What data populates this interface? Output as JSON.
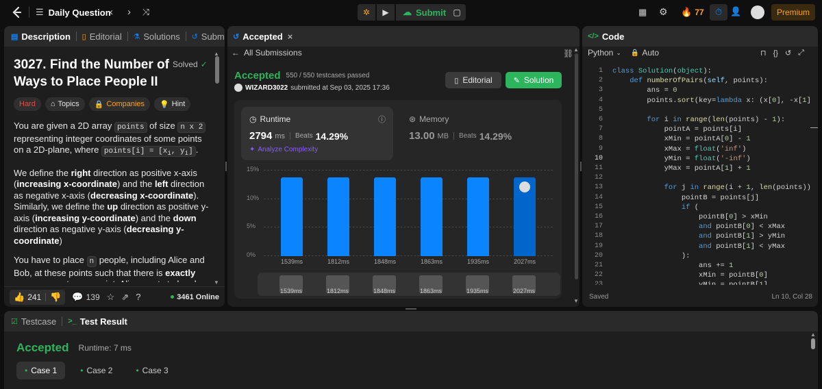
{
  "topbar": {
    "problem_list": "Daily Question",
    "submit": "Submit",
    "streak": "77",
    "premium": "Premium"
  },
  "left": {
    "tabs": [
      "Description",
      "Editorial",
      "Solutions",
      "Submissio"
    ],
    "title_line1": "3027. Find the Number of",
    "title_line2": "Ways to Place People II",
    "solved": "Solved",
    "tags": {
      "difficulty": "Hard",
      "topics": "Topics",
      "companies": "Companies",
      "hint": "Hint"
    },
    "likes": "241",
    "comments": "139",
    "online": "3461 Online"
  },
  "middle": {
    "tab": "Accepted",
    "back": "All Submissions",
    "status": "Accepted",
    "testcases": "550 / 550 testcases passed",
    "user": "WIZARD3022",
    "submitted": "submitted at Sep 03, 2025 17:36",
    "editorial_btn": "Editorial",
    "solution_btn": "Solution",
    "runtime_label": "Runtime",
    "runtime_value": "2794",
    "runtime_unit": "ms",
    "beats_label": "Beats",
    "runtime_beats": "14.29%",
    "analyze": "Analyze Complexity",
    "memory_label": "Memory",
    "memory_value": "13.00",
    "memory_unit": "MB",
    "memory_beats": "14.29%"
  },
  "chart_data": {
    "type": "bar",
    "categories": [
      "1539ms",
      "1812ms",
      "1848ms",
      "1863ms",
      "1935ms",
      "2027ms"
    ],
    "values": [
      13.8,
      13.8,
      13.8,
      13.8,
      13.8,
      13.8
    ],
    "y_ticks": [
      "15%",
      "10%",
      "5%",
      "0%"
    ],
    "ylim": [
      0,
      15
    ],
    "highlight_index": 5,
    "grid": true
  },
  "right": {
    "tab": "Code",
    "language": "Python",
    "mode": "Auto",
    "saved": "Saved",
    "cursor": "Ln 10, Col 28",
    "line_numbers": [
      "1",
      "2",
      "3",
      "4",
      "5",
      "6",
      "7",
      "8",
      "9",
      "10",
      "11",
      "12",
      "13",
      "14",
      "15",
      "16",
      "17",
      "18",
      "19",
      "20",
      "21",
      "22",
      "23"
    ]
  },
  "bottom": {
    "tab1": "Testcase",
    "tab2": "Test Result",
    "status": "Accepted",
    "runtime": "Runtime: 7 ms",
    "cases": [
      "Case 1",
      "Case 2",
      "Case 3"
    ]
  },
  "colors": {
    "accent_green": "#2db55d",
    "accent_orange": "#ffa116",
    "bar_blue": "#0a84ff",
    "hard_red": "#ef4743"
  }
}
